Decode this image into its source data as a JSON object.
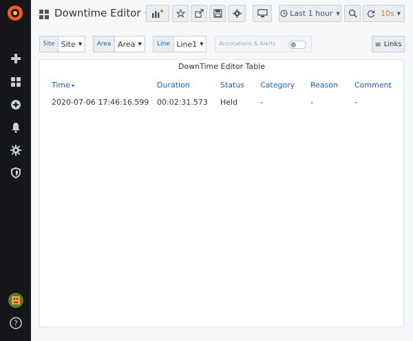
{
  "sidebar": {
    "items": [
      {
        "name": "plus-icon"
      },
      {
        "name": "dashboards-icon"
      },
      {
        "name": "explore-icon"
      },
      {
        "name": "alerting-bell-icon"
      },
      {
        "name": "configuration-gear-icon"
      },
      {
        "name": "server-admin-shield-icon"
      }
    ],
    "help_label": "?"
  },
  "header": {
    "title": "Downtime Editor",
    "time_range": "Last 1 hour",
    "refresh_interval": "10s"
  },
  "variables": [
    {
      "label": "Site",
      "value": "Site"
    },
    {
      "label": "Area",
      "value": "Area"
    },
    {
      "label": "Line",
      "value": "Line1"
    }
  ],
  "annotations_label": "Annotations & Alerts",
  "links_label": "Links",
  "panel": {
    "title": "DownTime Editor Table",
    "columns": [
      "Time",
      "Duration",
      "Status",
      "Category",
      "Reason",
      "Comment"
    ],
    "sort_indicator": "▾",
    "rows": [
      [
        "2020-07-06 17:46:16.599",
        "00:02:31.573",
        "Held",
        "-",
        "-",
        "-"
      ]
    ]
  },
  "colors": {
    "sidebar_bg": "#141619",
    "link_blue": "#1f60c4",
    "refresh_orange": "#eb7b18",
    "grafana_logo": "#f05a28"
  }
}
